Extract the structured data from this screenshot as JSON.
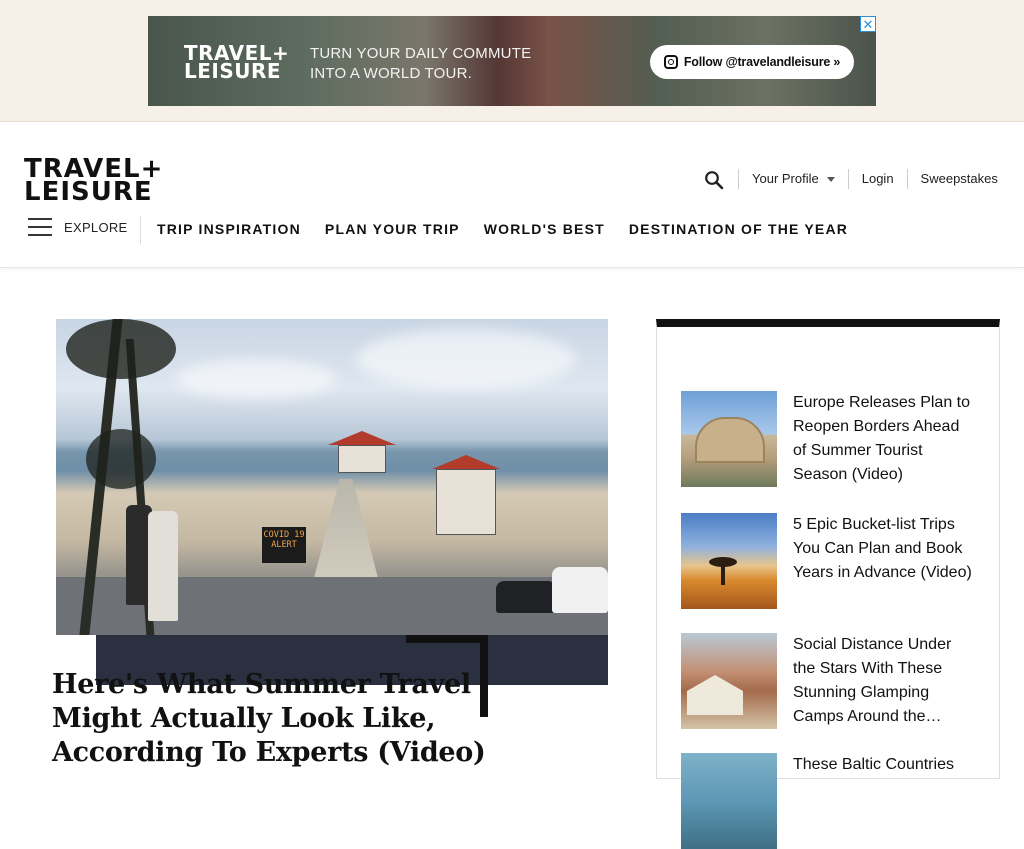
{
  "ad": {
    "logo_line1": "TRAVEL+",
    "logo_line2": "LEISURE",
    "tagline_line1": "TURN YOUR DAILY COMMUTE",
    "tagline_line2": "INTO A WORLD TOUR.",
    "follow_label": "Follow @travelandleisure »",
    "close_label": "✕"
  },
  "header": {
    "logo_line1": "TRAVEL+",
    "logo_line2": "LEISURE",
    "utility": {
      "profile_label": "Your Profile",
      "login_label": "Login",
      "sweepstakes_label": "Sweepstakes"
    },
    "explore_label": "EXPLORE",
    "nav": [
      {
        "label": "TRIP INSPIRATION"
      },
      {
        "label": "PLAN YOUR TRIP"
      },
      {
        "label": "WORLD'S BEST"
      },
      {
        "label": "DESTINATION OF THE YEAR"
      }
    ]
  },
  "feature": {
    "title": "Here's What Summer Travel Might Actually Look Like, According To Experts (Video)",
    "sign_text": "COVID 19 ALERT"
  },
  "sidebar": {
    "items": [
      {
        "title": "Europe Releases Plan to Reopen Borders Ahead of Summer Tourist Season (Video)",
        "thumb": "colosseum"
      },
      {
        "title": "5 Epic Bucket-list Trips You Can Plan and Book Years in Advance (Video)",
        "thumb": "savanna-sunset"
      },
      {
        "title": "Social Distance Under the Stars With These Stunning Glamping Camps Around the…",
        "thumb": "glamping-tent"
      },
      {
        "title": "These Baltic Countries",
        "thumb": "baltic-coast"
      }
    ]
  },
  "colors": {
    "ad_band_bg": "#f6f0e8",
    "text_primary": "#111111",
    "accent_black": "#111111",
    "ad_close_blue": "#2d8fd8"
  }
}
